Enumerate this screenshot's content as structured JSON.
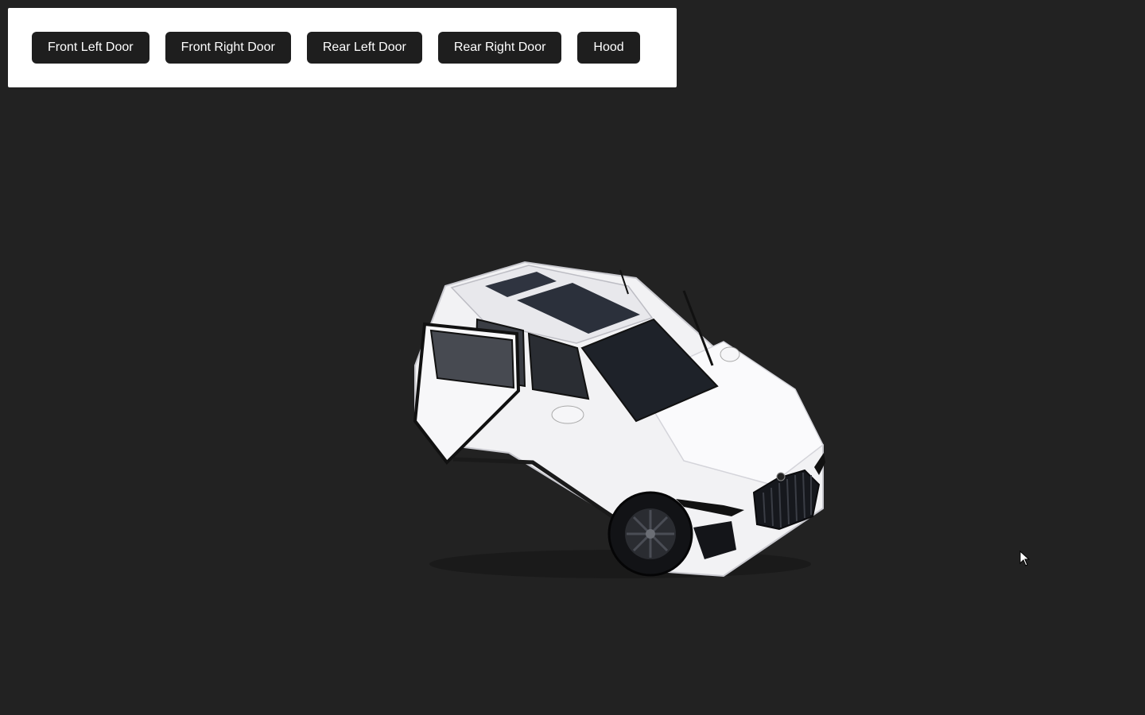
{
  "toolbar": {
    "buttons": [
      {
        "label": "Front Left Door"
      },
      {
        "label": "Front Right Door"
      },
      {
        "label": "Rear Left Door"
      },
      {
        "label": "Rear Right Door"
      },
      {
        "label": "Hood"
      }
    ]
  },
  "scene": {
    "background_color": "#222222",
    "model": "white-suv-3d-model",
    "icon": "mouse-pointer-icon"
  }
}
